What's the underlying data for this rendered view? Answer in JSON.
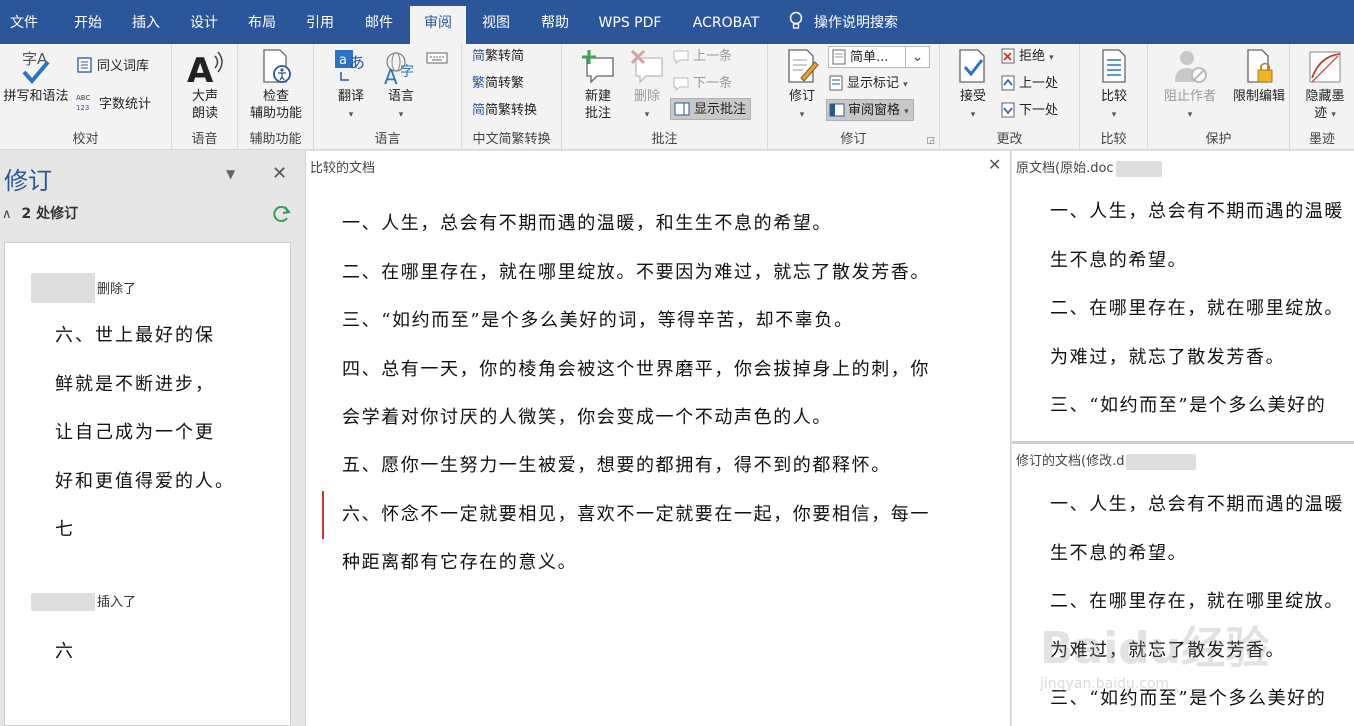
{
  "tabs": [
    "文件",
    "开始",
    "插入",
    "设计",
    "布局",
    "引用",
    "邮件",
    "审阅",
    "视图",
    "帮助",
    "WPS PDF",
    "ACROBAT"
  ],
  "tell_me": "操作说明搜索",
  "ribbon": {
    "proofing": {
      "spelling": "拼写和语法",
      "thesaurus": "同义词库",
      "wordcount": "字数统计",
      "label": "校对"
    },
    "speech": {
      "read_aloud_1": "大声",
      "read_aloud_2": "朗读",
      "label": "语音"
    },
    "accessibility": {
      "check_1": "检查",
      "check_2": "辅助功能",
      "label": "辅助功能"
    },
    "language": {
      "translate": "翻译",
      "language": "语言",
      "label": "语言"
    },
    "chinese": {
      "t2s": "繁转简",
      "s2t": "简转繁",
      "convert": "简繁转换",
      "label": "中文简繁转换"
    },
    "comments": {
      "new_1": "新建",
      "new_2": "批注",
      "delete": "删除",
      "prev": "上一条",
      "next": "下一条",
      "show": "显示批注",
      "label": "批注"
    },
    "tracking": {
      "track_changes": "修订",
      "markup_select": "简单...",
      "show_markup": "显示标记",
      "reviewing_pane": "审阅窗格",
      "label": "修订"
    },
    "changes": {
      "accept": "接受",
      "reject": "拒绝",
      "previous": "上一处",
      "next": "下一处",
      "label": "更改"
    },
    "compare": {
      "compare": "比较",
      "label": "比较"
    },
    "protect": {
      "block_authors": "阻止作者",
      "restrict": "限制编辑",
      "label": "保护"
    },
    "ink": {
      "hide_ink_1": "隐藏墨",
      "hide_ink_2": "迹",
      "label": "墨迹"
    }
  },
  "revisions_pane": {
    "title": "修订",
    "summary": "2 处修订",
    "deleted_label": "删除了",
    "deleted_lines": [
      "六、世上最好的保",
      "鲜就是不断进步，",
      "让自己成为一个更",
      "好和更值得爱的人。",
      "七"
    ],
    "inserted_label": "插入了",
    "inserted_lines": [
      "六"
    ]
  },
  "compared_doc": {
    "header": "比较的文档",
    "lines": [
      "一、人生，总会有不期而遇的温暖，和生生不息的希望。",
      "二、在哪里存在，就在哪里绽放。不要因为难过，就忘了散发芳香。",
      "三、“如约而至”是个多么美好的词，等得辛苦，却不辜负。",
      "四、总有一天，你的棱角会被这个世界磨平，你会拔掉身上的刺，你",
      "会学着对你讨厌的人微笑，你会变成一个不动声色的人。",
      "五、愿你一生努力一生被爱，想要的都拥有，得不到的都释怀。",
      "六、怀念不一定就要相见，喜欢不一定就要在一起，你要相信，每一",
      "种距离都有它存在的意义。"
    ]
  },
  "original_doc": {
    "header": "原文档(原始.doc",
    "lines": [
      "一、人生，总会有不期而遇的温暖",
      "生不息的希望。",
      "二、在哪里存在，就在哪里绽放。",
      "为难过，就忘了散发芳香。",
      "三、“如约而至”是个多么美好的"
    ]
  },
  "revised_doc": {
    "header": "修订的文档(修改.d",
    "lines": [
      "一、人生，总会有不期而遇的温暖",
      "生不息的希望。",
      "二、在哪里存在，就在哪里绽放。",
      "为难过，就忘了散发芳香。",
      "三、“如约而至”是个多么美好的"
    ]
  },
  "watermark": {
    "logo": "Baidu经验",
    "url": "jingyan.baidu.com"
  },
  "colors": {
    "accent": "#2b579a",
    "change_bar": "#c0392b",
    "refresh": "#2e9e4f"
  }
}
